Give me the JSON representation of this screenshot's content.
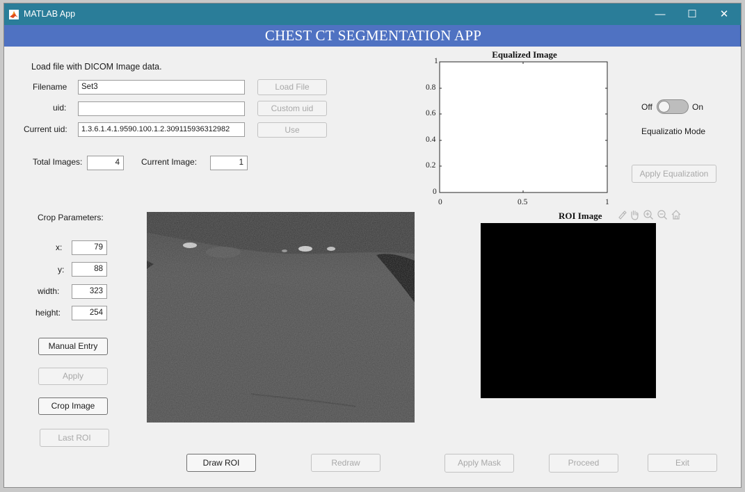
{
  "window": {
    "title": "MATLAB App",
    "minimize": "—",
    "maximize": "☐",
    "close": "✕"
  },
  "banner": "CHEST CT SEGMENTATION APP",
  "load_section": {
    "heading": "Load file with DICOM Image data.",
    "filename_label": "Filename",
    "filename_value": "Set3",
    "uid_label": "uid:",
    "uid_value": "",
    "current_uid_label": "Current uid:",
    "current_uid_value": "1.3.6.1.4.1.9590.100.1.2.309115936312982",
    "load_file_button": "Load File",
    "custom_uid_button": "Custom uid",
    "use_button": "Use",
    "total_images_label": "Total Images:",
    "total_images_value": "4",
    "current_image_label": "Current Image:",
    "current_image_value": "1"
  },
  "crop": {
    "heading": "Crop Parameters:",
    "x_label": "x:",
    "x_value": "79",
    "y_label": "y:",
    "y_value": "88",
    "width_label": "width:",
    "width_value": "323",
    "height_label": "height:",
    "height_value": "254",
    "manual_entry_button": "Manual Entry",
    "apply_button": "Apply",
    "crop_image_button": "Crop Image",
    "last_roi_button": "Last ROI"
  },
  "equalized_plot": {
    "title": "Equalized Image",
    "y_ticks": [
      "1",
      "0.8",
      "0.6",
      "0.4",
      "0.2",
      "0"
    ],
    "x_ticks": [
      "0",
      "0.5",
      "1"
    ]
  },
  "equalization": {
    "off_label": "Off",
    "on_label": "On",
    "state": "Off",
    "mode_label": "Equalizatio Mode",
    "apply_button": "Apply Equalization"
  },
  "roi": {
    "title": "ROI Image",
    "toolbar_icons": [
      "brush-icon",
      "pan-hand-icon",
      "zoom-in-icon",
      "zoom-out-icon",
      "home-icon"
    ]
  },
  "bottom_buttons": {
    "draw_roi": "Draw ROI",
    "redraw": "Redraw",
    "apply_mask": "Apply Mask",
    "proceed": "Proceed",
    "exit": "Exit"
  },
  "colors": {
    "titlebar": "#2a7d99",
    "banner": "#4f72c2",
    "background": "#f0f0f0",
    "ct_image": "#4a4a4a",
    "roi_image": "#000000"
  }
}
